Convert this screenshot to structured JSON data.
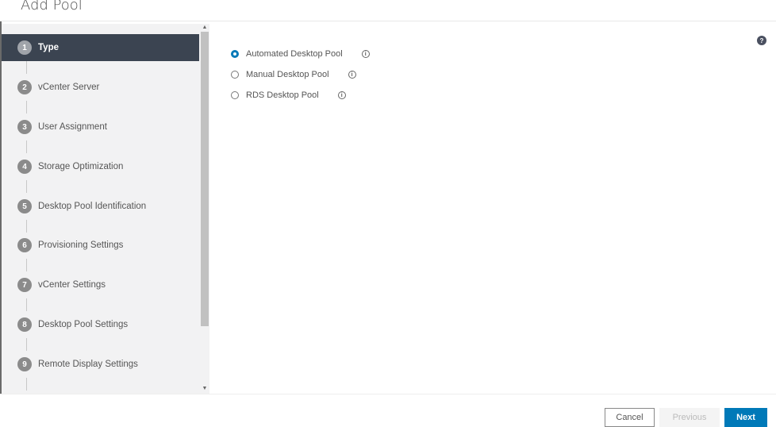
{
  "header": {
    "title": "Add Pool"
  },
  "steps": [
    {
      "num": "1",
      "label": "Type",
      "active": true
    },
    {
      "num": "2",
      "label": "vCenter Server"
    },
    {
      "num": "3",
      "label": "User Assignment"
    },
    {
      "num": "4",
      "label": "Storage Optimization"
    },
    {
      "num": "5",
      "label": "Desktop Pool Identification"
    },
    {
      "num": "6",
      "label": "Provisioning Settings"
    },
    {
      "num": "7",
      "label": "vCenter Settings"
    },
    {
      "num": "8",
      "label": "Desktop Pool Settings"
    },
    {
      "num": "9",
      "label": "Remote Display Settings"
    }
  ],
  "options": [
    {
      "label": "Automated Desktop Pool",
      "selected": true,
      "info": "i"
    },
    {
      "label": "Manual Desktop Pool",
      "selected": false,
      "info": "i"
    },
    {
      "label": "RDS Desktop Pool",
      "selected": false,
      "info": "i"
    }
  ],
  "help": {
    "glyph": "?"
  },
  "footer": {
    "cancel": "Cancel",
    "previous": "Previous",
    "next": "Next"
  },
  "colors": {
    "accent": "#0079b8",
    "active_step_bg": "#3b4451"
  }
}
